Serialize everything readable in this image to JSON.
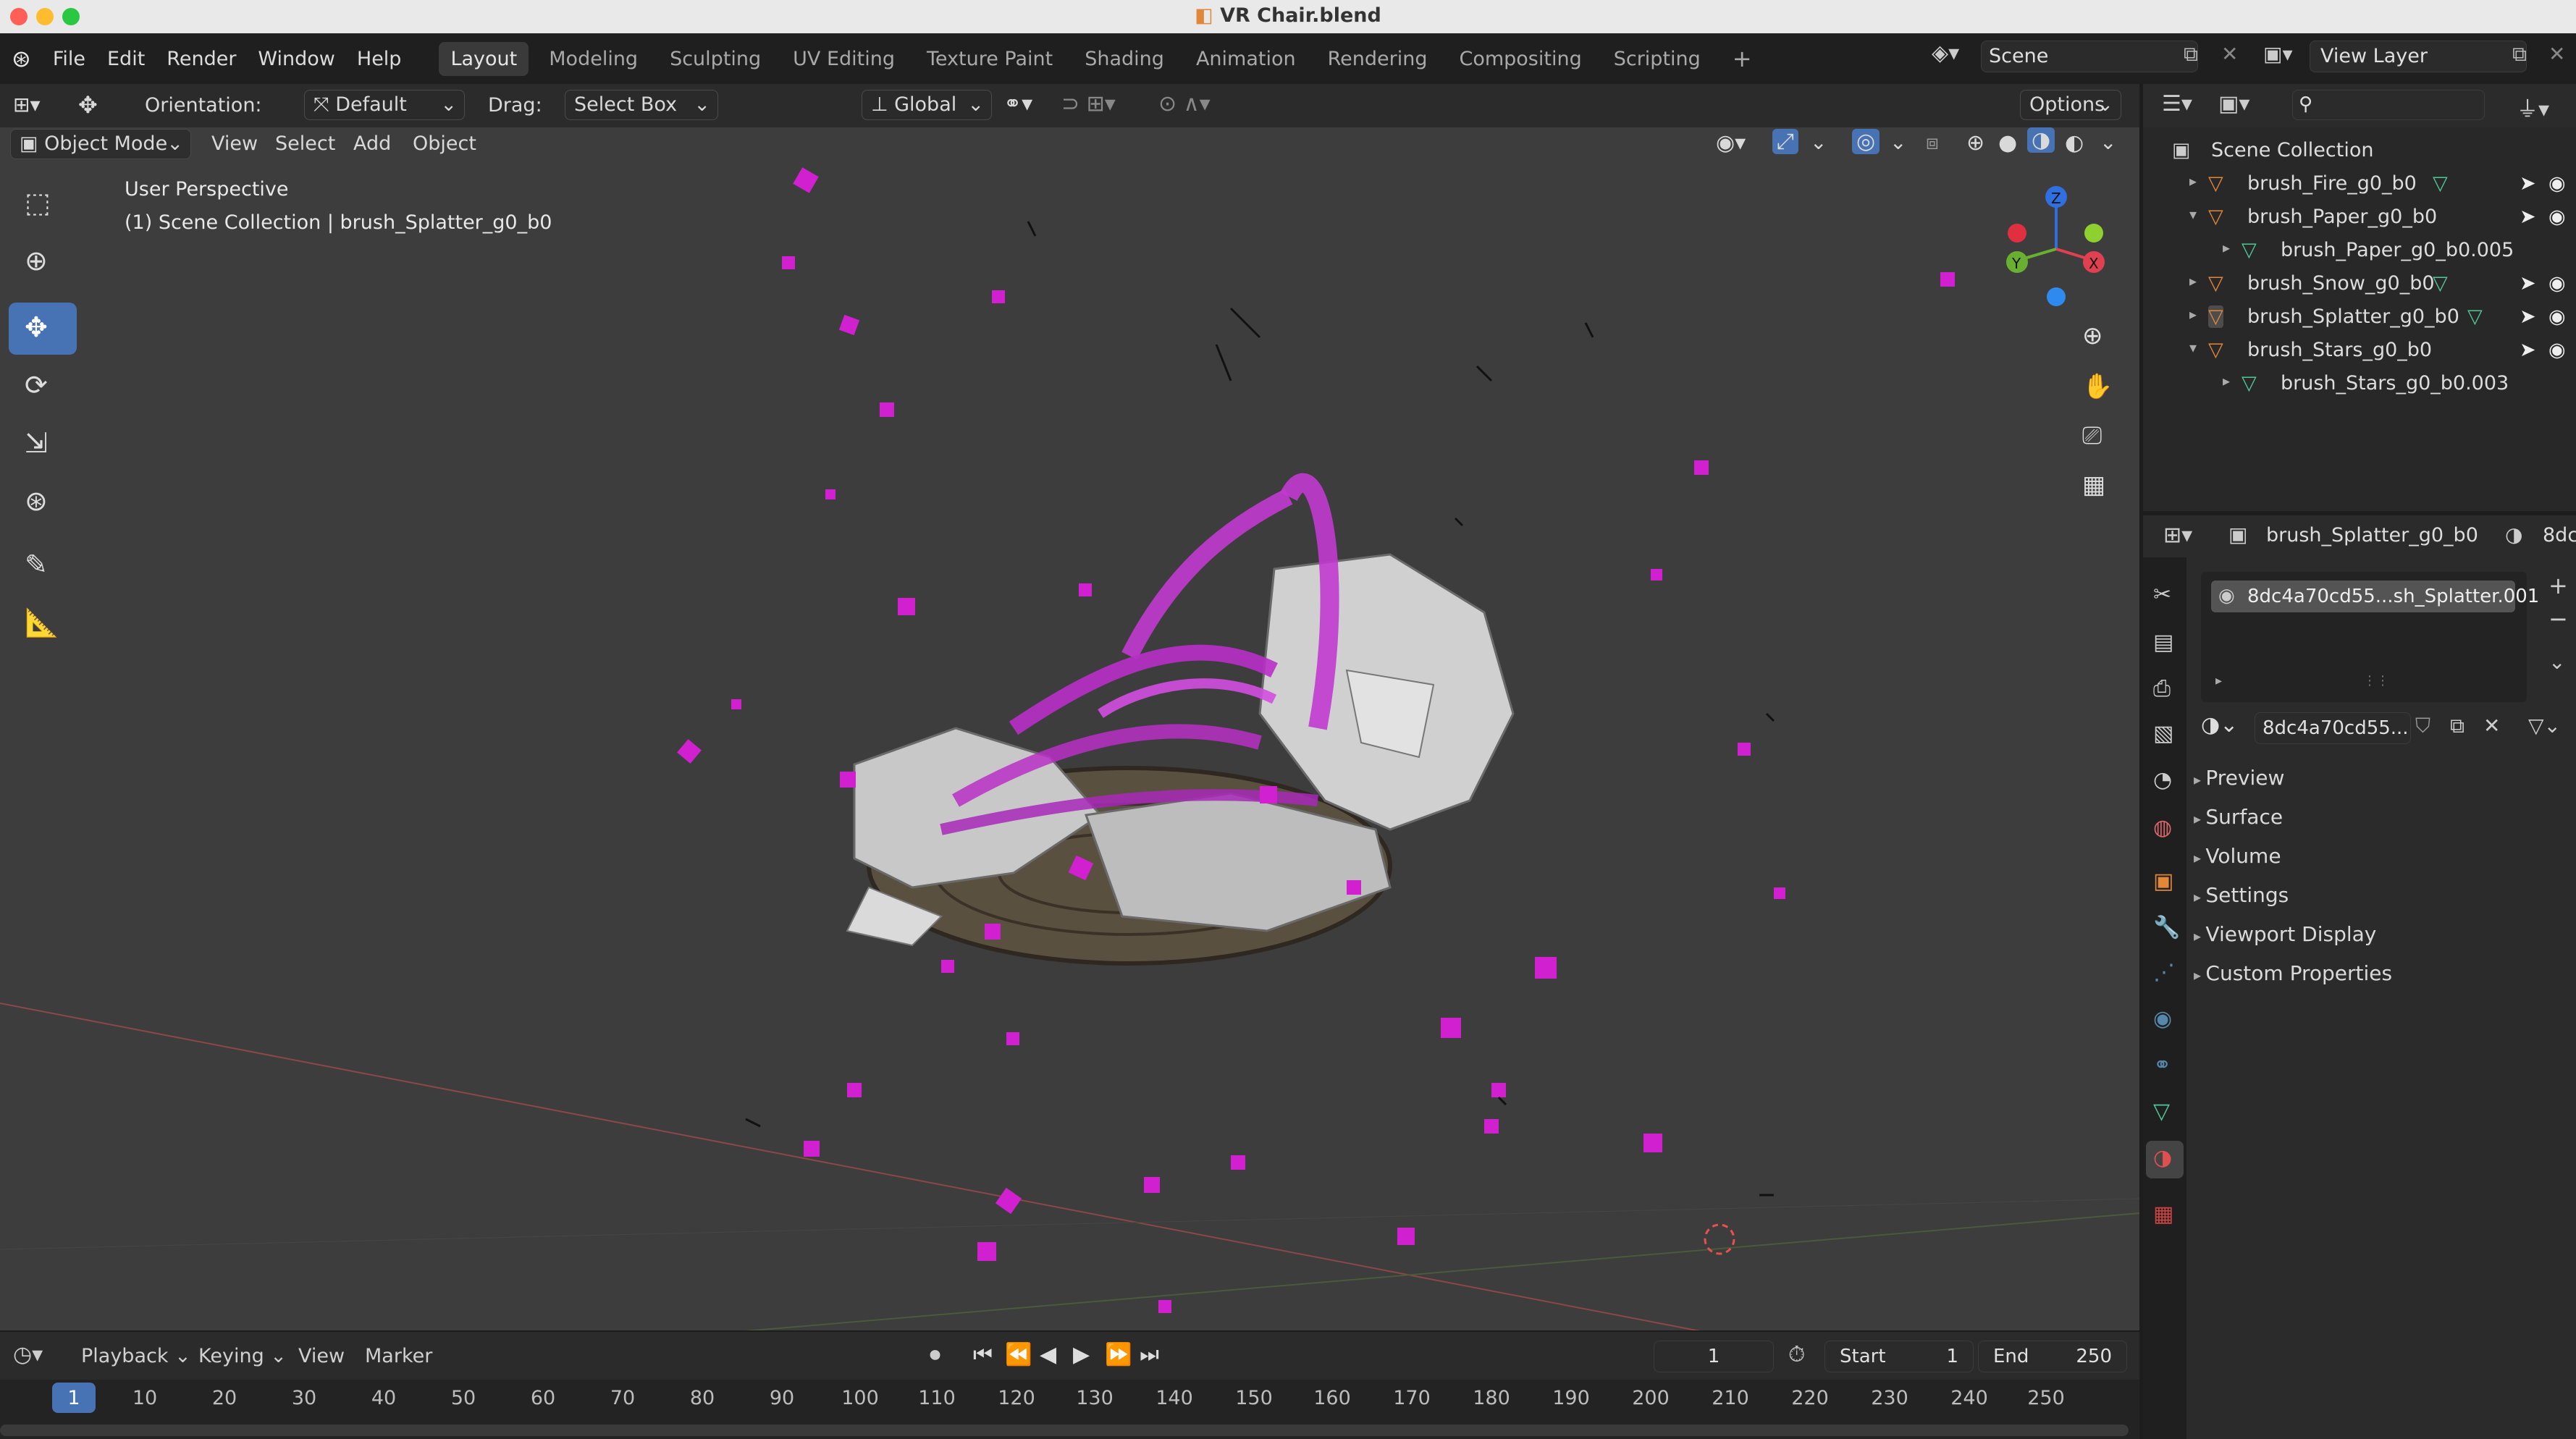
{
  "window": {
    "title": "VR Chair.blend"
  },
  "topbar": {
    "menus": [
      "File",
      "Edit",
      "Render",
      "Window",
      "Help"
    ],
    "workspaces": [
      "Layout",
      "Modeling",
      "Sculpting",
      "UV Editing",
      "Texture Paint",
      "Shading",
      "Animation",
      "Rendering",
      "Compositing",
      "Scripting"
    ],
    "active_workspace": "Layout",
    "add_workspace": "+",
    "scene_name": "Scene",
    "view_layer_name": "View Layer"
  },
  "tool_header": {
    "orientation_label": "Orientation:",
    "orientation_value": "Default",
    "drag_label": "Drag:",
    "drag_value": "Select Box",
    "transform_orientation": "Global",
    "options_label": "Options"
  },
  "viewport_header": {
    "mode": "Object Mode",
    "menus": [
      "View",
      "Select",
      "Add",
      "Object"
    ]
  },
  "viewport": {
    "perspective_label": "User Perspective",
    "collection_label": "(1) Scene Collection | brush_Splatter_g0_b0",
    "gizmo_axes": [
      "Z",
      "Y",
      "X"
    ]
  },
  "outliner": {
    "root": "Scene Collection",
    "items": [
      {
        "name": "brush_Fire_g0_b0",
        "type": "object",
        "indent": 0
      },
      {
        "name": "brush_Paper_g0_b0",
        "type": "object",
        "indent": 0
      },
      {
        "name": "brush_Paper_g0_b0.005",
        "type": "mesh",
        "indent": 1
      },
      {
        "name": "brush_Snow_g0_b0",
        "type": "object",
        "indent": 0
      },
      {
        "name": "brush_Splatter_g0_b0",
        "type": "object",
        "indent": 0
      },
      {
        "name": "brush_Stars_g0_b0",
        "type": "object",
        "indent": 0
      },
      {
        "name": "brush_Stars_g0_b0.003",
        "type": "mesh",
        "indent": 1
      }
    ]
  },
  "properties": {
    "object_name": "brush_Splatter_g0_b0",
    "object_name_trailing": "8dc",
    "material_slot": "8dc4a70cd55...sh_Splatter.001",
    "material_name": "8dc4a70cd55...",
    "panels": [
      "Preview",
      "Surface",
      "Volume",
      "Settings",
      "Viewport Display",
      "Custom Properties"
    ]
  },
  "timeline": {
    "menus": [
      "Playback",
      "Keying",
      "View",
      "Marker"
    ],
    "current_frame": "1",
    "start_label": "Start",
    "start_value": "1",
    "end_label": "End",
    "end_value": "250",
    "ruler": [
      "1",
      "10",
      "20",
      "30",
      "40",
      "50",
      "60",
      "70",
      "80",
      "90",
      "100",
      "110",
      "120",
      "130",
      "140",
      "150",
      "160",
      "170",
      "180",
      "190",
      "200",
      "210",
      "220",
      "230",
      "240",
      "250"
    ]
  },
  "colors": {
    "accent": "#4772b3",
    "magenta": "#cc27c9",
    "object_orange": "#e0873a",
    "mesh_green": "#4fc79b"
  }
}
